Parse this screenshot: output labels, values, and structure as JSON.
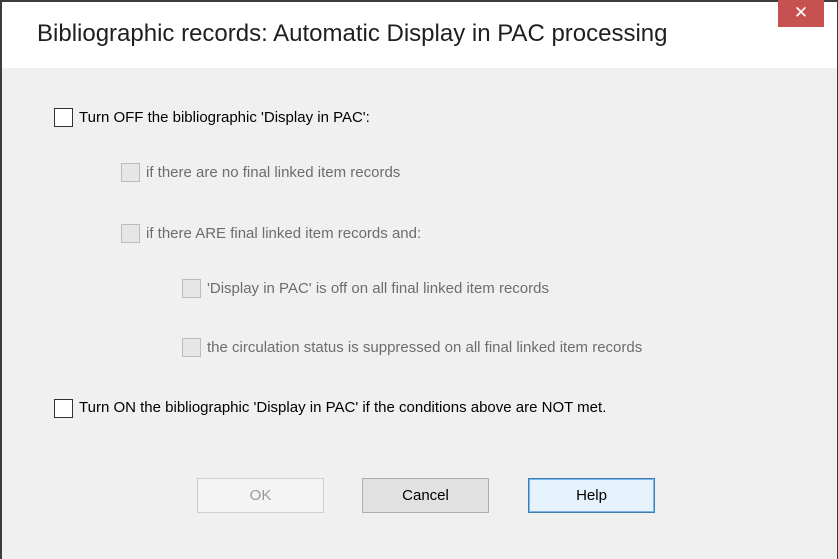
{
  "dialog": {
    "title": "Bibliographic records: Automatic Display in PAC processing",
    "close_glyph": "✕"
  },
  "options": {
    "turn_off": {
      "label": "Turn OFF the bibliographic 'Display in PAC':",
      "checked": false,
      "enabled": true
    },
    "no_final_items": {
      "label": "if there are no final linked item records",
      "checked": false,
      "enabled": false
    },
    "are_final_items": {
      "label": "if there ARE final linked item records and:",
      "checked": false,
      "enabled": false
    },
    "display_off_all": {
      "label": "'Display in PAC' is off on all final linked item records",
      "checked": false,
      "enabled": false
    },
    "circ_suppressed": {
      "label": "the circulation status is suppressed on all final linked item records",
      "checked": false,
      "enabled": false
    },
    "turn_on": {
      "label": "Turn ON the bibliographic 'Display in PAC' if the conditions above are NOT met.",
      "checked": false,
      "enabled": true
    }
  },
  "buttons": {
    "ok": "OK",
    "cancel": "Cancel",
    "help": "Help"
  },
  "colors": {
    "close_button": "#c75050",
    "dialog_background": "#f0f0f0",
    "help_focus_border": "#3c7fb1",
    "disabled_text": "#6d6d6d"
  }
}
